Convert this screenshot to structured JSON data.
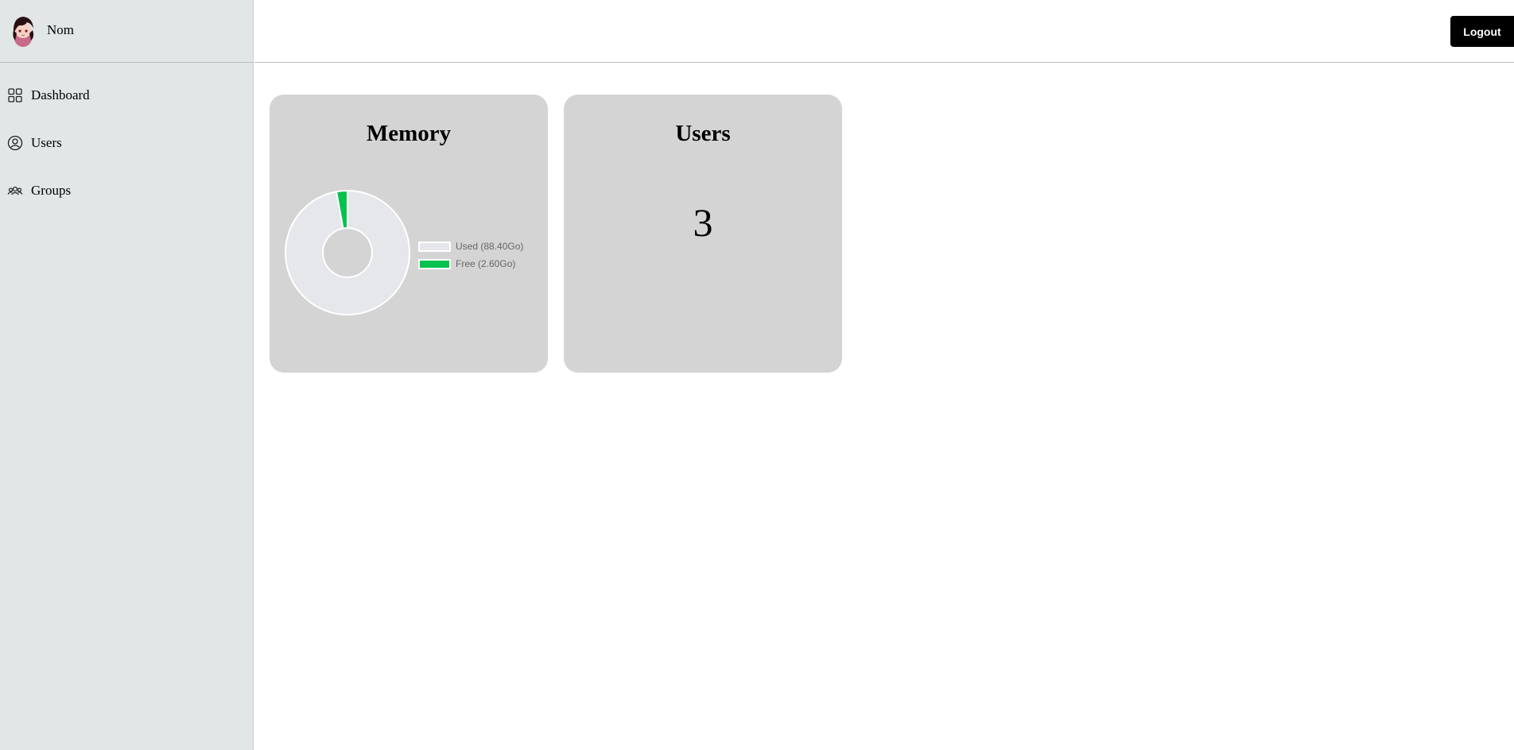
{
  "sidebar": {
    "user": {
      "name": "Nom",
      "avatar_icon": "avatar-image"
    },
    "items": [
      {
        "label": "Dashboard",
        "icon": "dashboard-grid-icon"
      },
      {
        "label": "Users",
        "icon": "user-circle-icon"
      },
      {
        "label": "Groups",
        "icon": "users-group-icon"
      }
    ]
  },
  "header": {
    "logout_label": "Logout"
  },
  "cards": {
    "memory": {
      "title": "Memory"
    },
    "users": {
      "title": "Users",
      "count": "3"
    }
  },
  "chart_data": {
    "type": "pie",
    "categories": [
      "Used (88.40Go)",
      "Free (2.60Go)"
    ],
    "values": [
      88.4,
      2.6
    ],
    "colors": [
      "#e5e7eb",
      "#08c14f"
    ],
    "title": "",
    "legend": "right"
  }
}
